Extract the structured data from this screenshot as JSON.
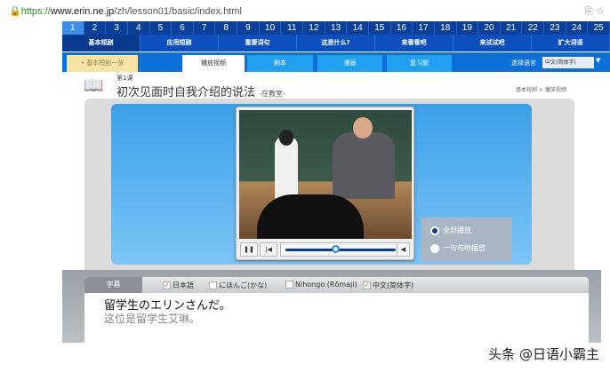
{
  "browser": {
    "url_scheme": "https://",
    "url_domain": "www.erin.ne.jp",
    "url_path": "/zh/lesson01/basic/index.html",
    "icons": "translate-icon star-icon"
  },
  "lesson_numbers": [
    "1",
    "2",
    "3",
    "4",
    "5",
    "6",
    "7",
    "8",
    "9",
    "10",
    "11",
    "12",
    "13",
    "14",
    "15",
    "16",
    "17",
    "18",
    "19",
    "20",
    "21",
    "22",
    "23",
    "24",
    "25"
  ],
  "nav": [
    "基本短剧",
    "应用短剧",
    "重要词句",
    "这是什么?",
    "来看看吧",
    "来试试吧",
    "扩大词语"
  ],
  "sub": {
    "list": "• 基本短剧一览",
    "tabs": [
      "播放视频",
      "剧本",
      "漫画",
      "复习题"
    ],
    "lang_label": "选择语言",
    "lang_value": "中文(简体字)"
  },
  "header": {
    "lesson": "第1课",
    "title": "初次见面时自我介绍的说法",
    "subtitle": "-在教室-",
    "breadcrumb": "基本短剧 > 播放视频"
  },
  "player": {
    "progress": 0.45,
    "pause": "❚❚",
    "prev": "|◀",
    "vol": "◀"
  },
  "modes": [
    {
      "label": "全部播放",
      "selected": true
    },
    {
      "label": "一句句地播放",
      "selected": false
    }
  ],
  "subtitles": {
    "heading": "字幕",
    "options": [
      {
        "label": "日本語",
        "checked": true
      },
      {
        "label": "にほんご(かな)",
        "checked": false
      },
      {
        "label": "Nihongo (Rōmaji)",
        "checked": false
      },
      {
        "label": "中文(简体字)",
        "checked": true
      }
    ],
    "jp": "留学生のエリンさんだ。",
    "zh": "这位是留学生艾琳。"
  },
  "watermark": "头条 @日语小霸主"
}
